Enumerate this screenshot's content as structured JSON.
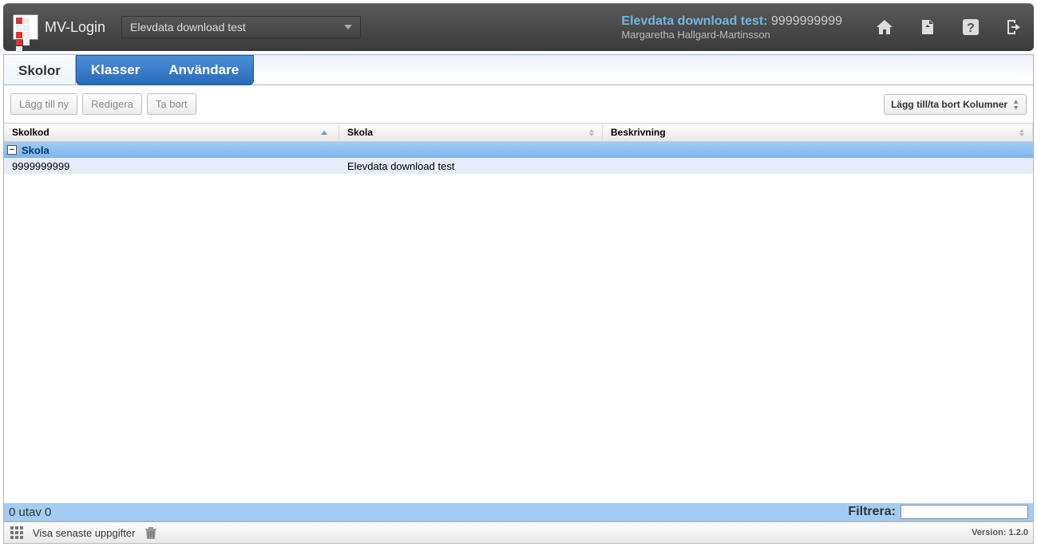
{
  "app": {
    "name": "MV-Login"
  },
  "selector": {
    "value": "Elevdata download test"
  },
  "context": {
    "title_prefix": "Elevdata download test:",
    "title_num": "9999999999",
    "user": "Margaretha Hallgard-Martinsson"
  },
  "top_icons": {
    "home": "home-icon",
    "export": "export-icon",
    "help": "help-icon",
    "logout": "logout-icon"
  },
  "tabs": {
    "active": "Skolor",
    "others": [
      "Klasser",
      "Användare"
    ]
  },
  "toolbar": {
    "add": "Lägg till ny",
    "edit": "Redigera",
    "delete": "Ta bort",
    "columns": "Lägg till/ta bort Kolumner"
  },
  "columns": {
    "skolkod": "Skolkod",
    "skola": "Skola",
    "beskrivning": "Beskrivning"
  },
  "group": {
    "label": "Skola",
    "collapse_symbol": "−"
  },
  "rows": [
    {
      "skolkod": "9999999999",
      "skola": "Elevdata download test",
      "beskrivning": ""
    }
  ],
  "status": {
    "count_text": "0 utav 0",
    "filter_label": "Filtrera:",
    "filter_value": ""
  },
  "footer": {
    "recent_label": "Visa senaste uppgifter",
    "version_label": "Version: 1.2.0"
  }
}
